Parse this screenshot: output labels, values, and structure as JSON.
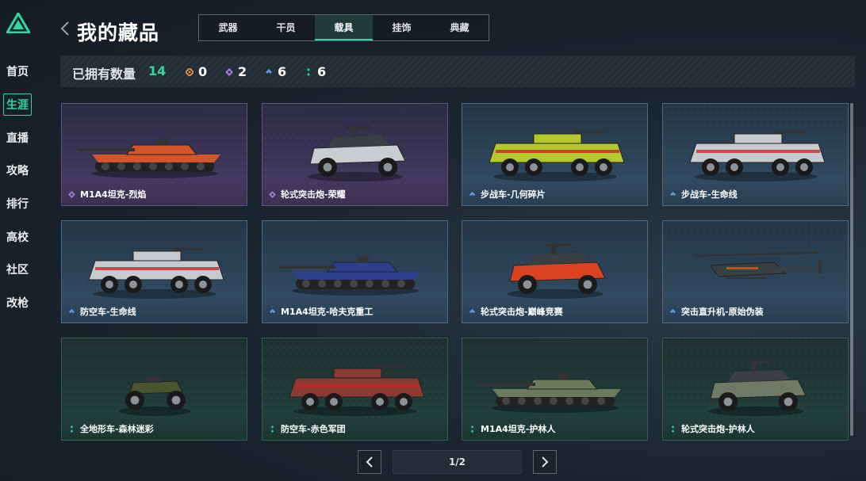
{
  "nav": {
    "items": [
      {
        "label": "首页",
        "active": false
      },
      {
        "label": "生涯",
        "active": true
      },
      {
        "label": "直播",
        "active": false
      },
      {
        "label": "攻略",
        "active": false
      },
      {
        "label": "排行",
        "active": false
      },
      {
        "label": "高校",
        "active": false
      },
      {
        "label": "社区",
        "active": false
      },
      {
        "label": "改枪",
        "active": false
      }
    ]
  },
  "header": {
    "title": "我的藏品",
    "back_icon": "chevron-left-icon"
  },
  "tabs": [
    {
      "label": "武器",
      "active": false
    },
    {
      "label": "干员",
      "active": false
    },
    {
      "label": "载具",
      "active": true
    },
    {
      "label": "挂饰",
      "active": false
    },
    {
      "label": "典藏",
      "active": false
    }
  ],
  "summary": {
    "owned_label": "已拥有数量",
    "owned_count": "14",
    "rarities": [
      {
        "icon": "gold-gem-icon",
        "color": "#d88a3e",
        "count": "0"
      },
      {
        "icon": "purple-gem-icon",
        "color": "#9b7ad6",
        "count": "2"
      },
      {
        "icon": "blue-gem-icon",
        "color": "#5b9ae0",
        "count": "6"
      },
      {
        "icon": "green-gem-icon",
        "color": "#2ec8a0",
        "count": "6"
      }
    ]
  },
  "colors": {
    "accent": "#2ed8a0",
    "purple": "#9b7ad6",
    "blue": "#5b9ae0",
    "green": "#2ec8a0"
  },
  "cards": [
    {
      "name": "M1A4坦克-烈焰",
      "rarity": "purple",
      "vehicle": "tank",
      "paint": "#d4552a"
    },
    {
      "name": "轮式突击炮-荣耀",
      "rarity": "purple",
      "vehicle": "buggy",
      "paint": "#c9cdd2"
    },
    {
      "name": "步战车-几何碎片",
      "rarity": "blue",
      "vehicle": "apc",
      "paint": "#b6c92a"
    },
    {
      "name": "步战车-生命线",
      "rarity": "blue",
      "vehicle": "apc",
      "paint": "#c7cbd0"
    },
    {
      "name": "防空车-生命线",
      "rarity": "blue",
      "vehicle": "apc",
      "paint": "#c7cbd0"
    },
    {
      "name": "M1A4坦克-哈夫克重工",
      "rarity": "blue",
      "vehicle": "tank",
      "paint": "#2c3f8c"
    },
    {
      "name": "轮式突击炮-巅峰竞赛",
      "rarity": "blue",
      "vehicle": "buggy",
      "paint": "#d9431f"
    },
    {
      "name": "突击直升机-原始伪装",
      "rarity": "blue",
      "vehicle": "heli",
      "paint": "#3a3f44"
    },
    {
      "name": "全地形车-森林迷彩",
      "rarity": "green",
      "vehicle": "atv",
      "paint": "#4a5530"
    },
    {
      "name": "防空车-赤色军团",
      "rarity": "green",
      "vehicle": "apc",
      "paint": "#8a3a30"
    },
    {
      "name": "M1A4坦克-护林人",
      "rarity": "green",
      "vehicle": "tank",
      "paint": "#6b7a5a"
    },
    {
      "name": "轮式突击炮-护林人",
      "rarity": "green",
      "vehicle": "buggy",
      "paint": "#6e7a66"
    }
  ],
  "pagination": {
    "page": "1/2",
    "prev_icon": "chevron-left-icon",
    "next_icon": "chevron-right-icon"
  }
}
